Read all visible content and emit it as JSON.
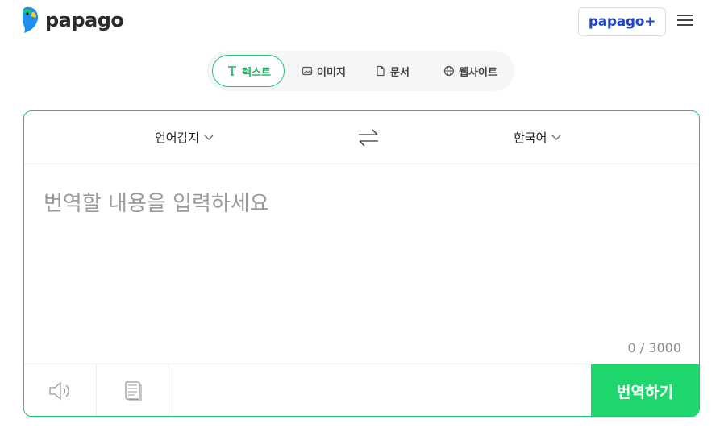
{
  "header": {
    "logo_text": "papago",
    "plus_label": "papago",
    "plus_suffix": "+"
  },
  "modes": [
    {
      "label": "텍스트",
      "icon": "text-T-icon",
      "active": true
    },
    {
      "label": "이미지",
      "icon": "image-icon",
      "active": false
    },
    {
      "label": "문서",
      "icon": "document-icon",
      "active": false
    },
    {
      "label": "웹사이트",
      "icon": "globe-icon",
      "active": false
    }
  ],
  "translator": {
    "source_language": "언어감지",
    "target_language": "한국어",
    "input_placeholder": "번역할 내용을 입력하세요",
    "input_value": "",
    "char_count": "0 / 3000",
    "translate_button": "번역하기"
  },
  "colors": {
    "accent": "#1ec66e",
    "translate_button": "#1ed66c",
    "brand_blue": "#1e43c8"
  }
}
